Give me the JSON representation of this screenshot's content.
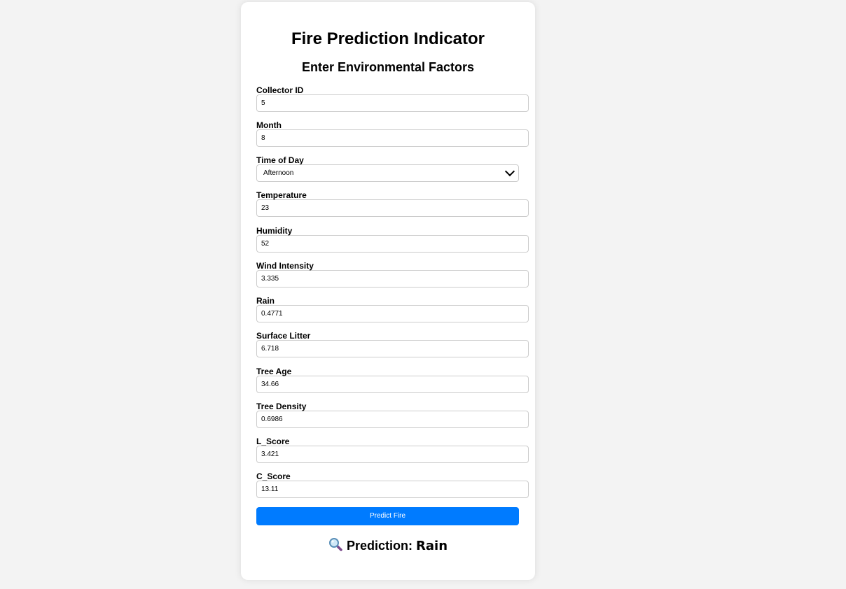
{
  "title": "Fire Prediction Indicator",
  "subtitle": "Enter Environmental Factors",
  "fields": {
    "collector_id": {
      "label": "Collector ID",
      "value": "5"
    },
    "month": {
      "label": "Month",
      "value": "8"
    },
    "time_of_day": {
      "label": "Time of Day",
      "value": "Afternoon"
    },
    "temperature": {
      "label": "Temperature",
      "value": "23"
    },
    "humidity": {
      "label": "Humidity",
      "value": "52"
    },
    "wind_intensity": {
      "label": "Wind Intensity",
      "value": "3.335"
    },
    "rain": {
      "label": "Rain",
      "value": "0.4771"
    },
    "surface_litter": {
      "label": "Surface Litter",
      "value": "6.718"
    },
    "tree_age": {
      "label": "Tree Age",
      "value": "34.66"
    },
    "tree_density": {
      "label": "Tree Density",
      "value": "0.6986"
    },
    "l_score": {
      "label": "L_Score",
      "value": "3.421"
    },
    "c_score": {
      "label": "C_Score",
      "value": "13.11"
    }
  },
  "button": {
    "label": "Predict Fire"
  },
  "result": {
    "icon": "magnifying-glass-icon",
    "label": "Prediction:",
    "value": "Rain"
  },
  "colors": {
    "background": "#f3f3f3",
    "card": "#ffffff",
    "button": "#007bff",
    "input_border": "#cccccc"
  }
}
